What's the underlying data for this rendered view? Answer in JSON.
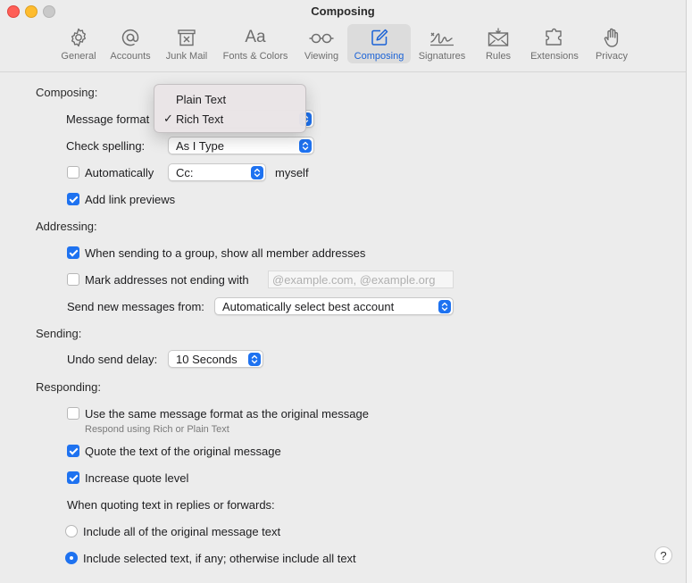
{
  "window": {
    "title": "Composing"
  },
  "toolbar": {
    "items": [
      {
        "label": "General",
        "icon": "gear-icon"
      },
      {
        "label": "Accounts",
        "icon": "at-icon"
      },
      {
        "label": "Junk Mail",
        "icon": "junk-trash-icon"
      },
      {
        "label": "Fonts & Colors",
        "icon": "font-aa-icon"
      },
      {
        "label": "Viewing",
        "icon": "glasses-icon"
      },
      {
        "label": "Composing",
        "icon": "compose-pencil-icon",
        "active": true
      },
      {
        "label": "Signatures",
        "icon": "signature-icon"
      },
      {
        "label": "Rules",
        "icon": "rules-envelope-icon"
      },
      {
        "label": "Extensions",
        "icon": "puzzle-icon"
      },
      {
        "label": "Privacy",
        "icon": "hand-icon"
      }
    ],
    "fonts_icon_text": "Aa"
  },
  "composing": {
    "header": "Composing:",
    "message_format_label": "Message format",
    "check_spelling_label": "Check spelling:",
    "check_spelling_value": "As I Type",
    "automatically_label": "Automatically",
    "automatically_checked": false,
    "cc_value": "Cc:",
    "myself_label": "myself",
    "link_previews_label": "Add link previews",
    "link_previews_checked": true
  },
  "format_menu": {
    "options": [
      {
        "label": "Plain Text",
        "checked": false
      },
      {
        "label": "Rich Text",
        "checked": true
      }
    ],
    "check_glyph": "✓"
  },
  "addressing": {
    "header": "Addressing:",
    "group_label": "When sending to a group, show all member addresses",
    "group_checked": true,
    "mark_label": "Mark addresses not ending with",
    "mark_checked": false,
    "mark_placeholder": "@example.com, @example.org",
    "send_from_label": "Send new messages from:",
    "send_from_value": "Automatically select best account"
  },
  "sending": {
    "header": "Sending:",
    "undo_label": "Undo send delay:",
    "undo_value": "10 Seconds"
  },
  "responding": {
    "header": "Responding:",
    "same_format_label": "Use the same message format as the original message",
    "same_format_checked": false,
    "same_format_hint": "Respond using Rich or Plain Text",
    "quote_label": "Quote the text of the original message",
    "quote_checked": true,
    "increase_label": "Increase quote level",
    "increase_checked": true,
    "quoting_label": "When quoting text in replies or forwards:",
    "include_all_label": "Include all of the original message text",
    "include_selected_label": "Include selected text, if any; otherwise include all text",
    "selected_option": "include_selected"
  },
  "help": {
    "label": "?"
  },
  "colors": {
    "accent": "#1e72f0",
    "background": "#ececec"
  }
}
